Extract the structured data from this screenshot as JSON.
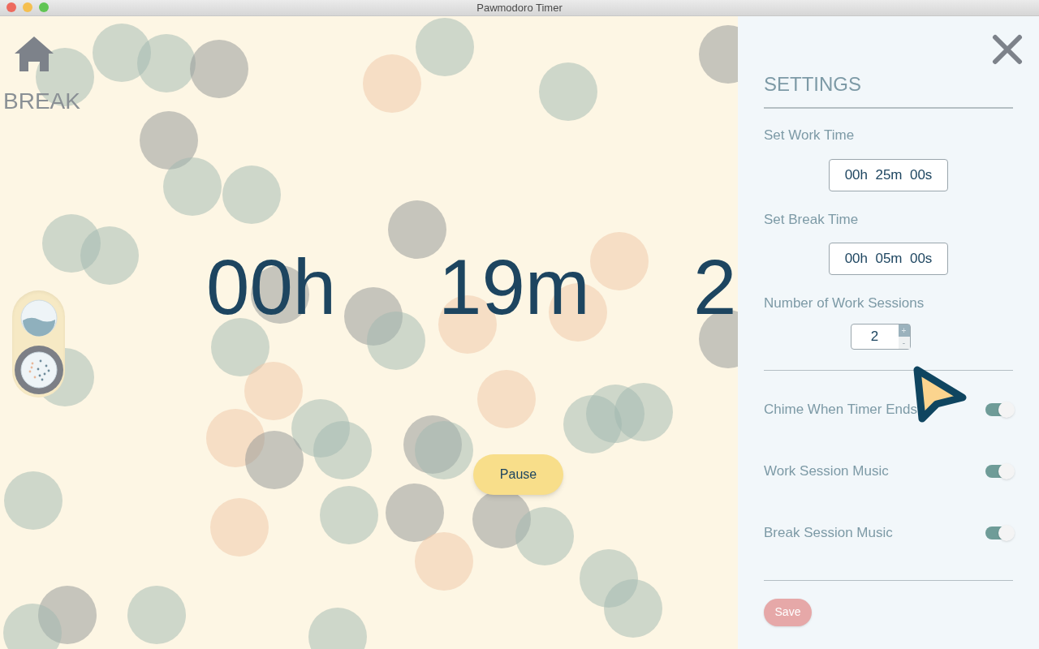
{
  "window": {
    "title": "Pawmodoro Timer"
  },
  "mode": {
    "label": "BREAK"
  },
  "mode_switch": [
    {
      "kind": "water",
      "selected": false
    },
    {
      "kind": "dots",
      "selected": true
    }
  ],
  "timer": {
    "hours": "00h",
    "minutes": "19m",
    "seconds": "2"
  },
  "pause_button": "Pause",
  "settings": {
    "title": "SETTINGS",
    "work_time": {
      "label": "Set Work Time",
      "value": "00h  25m  00s"
    },
    "break_time": {
      "label": "Set Break Time",
      "value": "00h  05m  00s"
    },
    "sessions": {
      "label": "Number of Work Sessions",
      "value": "2",
      "increment": "+",
      "decrement": "-"
    },
    "toggles": [
      {
        "label": "Chime When Timer Ends",
        "on": true
      },
      {
        "label": "Work Session Music",
        "on": true
      },
      {
        "label": "Break Session Music",
        "on": true
      }
    ],
    "save_button": "Save"
  }
}
